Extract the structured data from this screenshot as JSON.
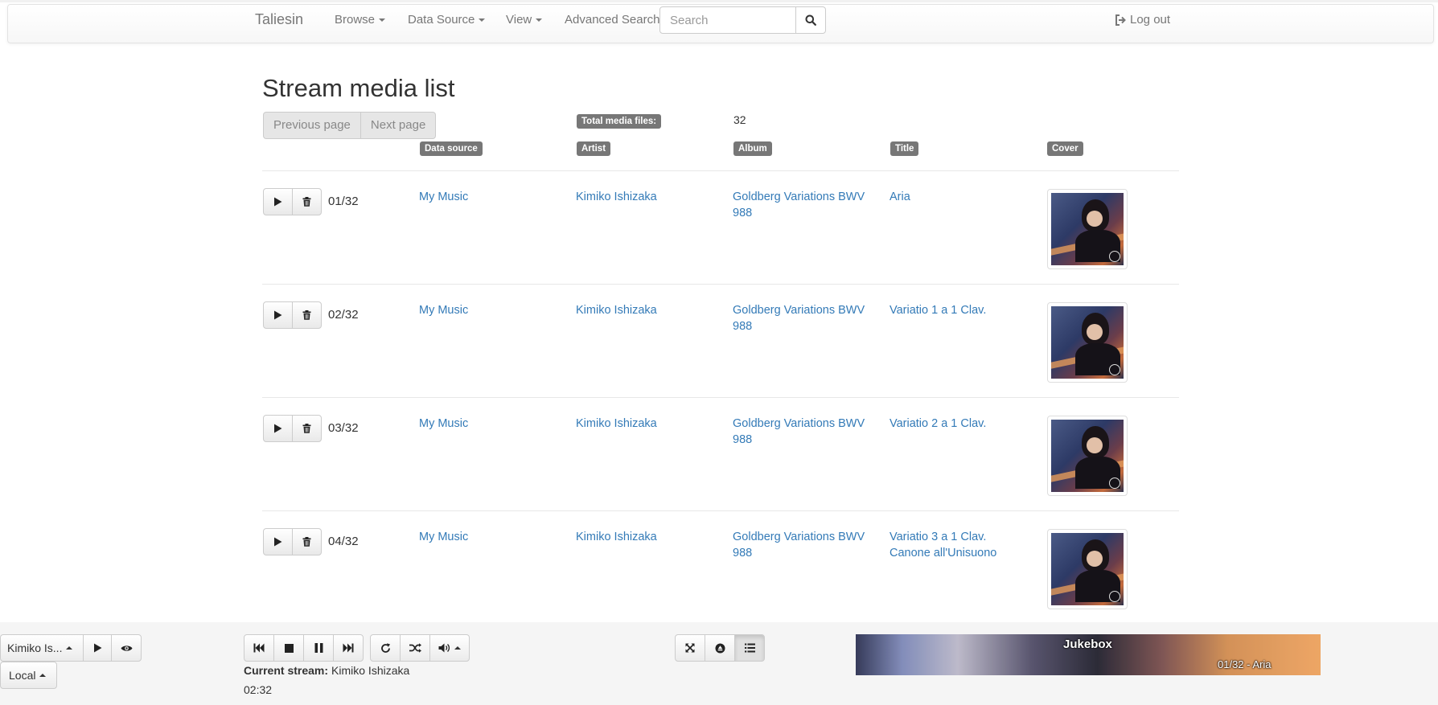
{
  "navbar": {
    "brand": "Taliesin",
    "browse": "Browse",
    "data_source": "Data Source",
    "view": "View",
    "advanced_search": "Advanced Search",
    "search_placeholder": "Search",
    "logout": "Log out"
  },
  "page": {
    "title": "Stream media list",
    "previous": "Previous page",
    "next": "Next page",
    "total_label": "Total media files:",
    "total_value": "32"
  },
  "columns": {
    "data_source": "Data source",
    "artist": "Artist",
    "album": "Album",
    "title": "Title",
    "cover": "Cover"
  },
  "rows": [
    {
      "position": "01/32",
      "data_source": "My Music",
      "artist": "Kimiko Ishizaka",
      "album": "Goldberg Variations BWV 988",
      "title": "Aria"
    },
    {
      "position": "02/32",
      "data_source": "My Music",
      "artist": "Kimiko Ishizaka",
      "album": "Goldberg Variations BWV 988",
      "title": "Variatio 1 a 1 Clav."
    },
    {
      "position": "03/32",
      "data_source": "My Music",
      "artist": "Kimiko Ishizaka",
      "album": "Goldberg Variations BWV 988",
      "title": "Variatio 2 a 1 Clav."
    },
    {
      "position": "04/32",
      "data_source": "My Music",
      "artist": "Kimiko Ishizaka",
      "album": "Goldberg Variations BWV 988",
      "title": "Variatio 3 a 1 Clav. Canone all'Unisuono"
    }
  ],
  "player": {
    "stream_select": "Kimiko Is...",
    "player_select": "Local",
    "current_stream_label": "Current stream:",
    "current_stream_value": "Kimiko Ishizaka",
    "time": "02:32",
    "jukebox_title": "Jukebox",
    "jukebox_track": "01/32 - Aria"
  },
  "icons": {
    "search": "search-icon",
    "logout": "logout-icon",
    "play": "play-icon",
    "delete": "trash-icon",
    "eye": "eye-icon",
    "prev": "skip-backward-icon",
    "stop": "stop-icon",
    "pause": "pause-icon",
    "next": "skip-forward-icon",
    "repeat": "repeat-icon",
    "shuffle": "shuffle-icon",
    "volume": "volume-icon",
    "fullscreen": "fullscreen-icon",
    "eject": "eject-icon",
    "list": "list-icon"
  },
  "colors": {
    "link": "#337ab7",
    "label_bg": "#777777",
    "player_bg": "#f5f5f5"
  }
}
